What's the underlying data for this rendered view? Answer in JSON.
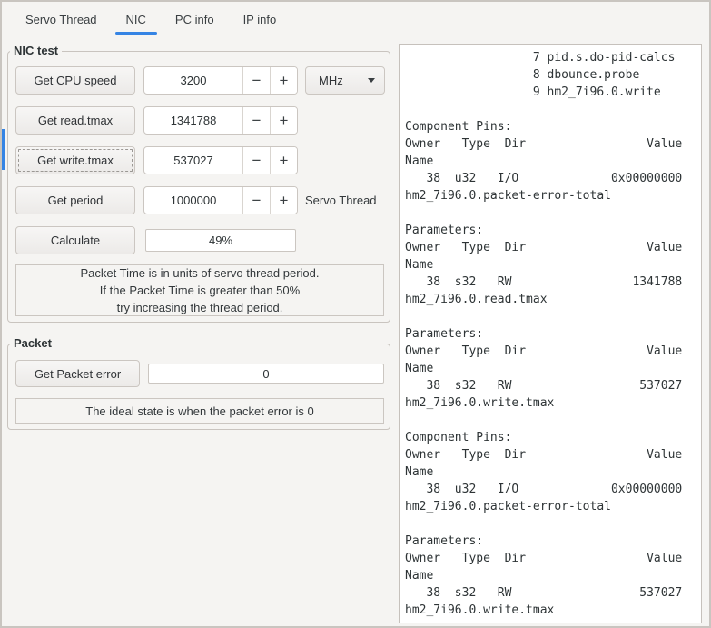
{
  "colors": {
    "accent": "#3584e4"
  },
  "tabs": {
    "servo_thread": "Servo Thread",
    "nic": "NIC",
    "pc_info": "PC info",
    "ip_info": "IP info"
  },
  "icons": {
    "minus": "−",
    "plus": "+"
  },
  "nic_test": {
    "title": "NIC test",
    "cpu_speed": {
      "button": "Get CPU speed",
      "value": "3200",
      "unit": "MHz"
    },
    "read_tmax": {
      "button": "Get read.tmax",
      "value": "1341788"
    },
    "write_tmax": {
      "button": "Get write.tmax",
      "value": "537027"
    },
    "period": {
      "button": "Get period",
      "value": "1000000",
      "label": "Servo Thread"
    },
    "calculate": {
      "button": "Calculate",
      "value": "49%"
    },
    "note": [
      "Packet Time is in units of servo thread period.",
      "If the Packet Time is greater than 50%",
      "try increasing the thread period."
    ]
  },
  "packet": {
    "title": "Packet",
    "button": "Get Packet error",
    "value": "0",
    "note": "The ideal state is when the packet error is 0"
  },
  "output": {
    "lines": [
      "                  7 pid.s.do-pid-calcs",
      "                  8 dbounce.probe",
      "                  9 hm2_7i96.0.write",
      "",
      "Component Pins:",
      "Owner   Type  Dir                 Value",
      "Name",
      "   38  u32   I/O             0x00000000",
      "hm2_7i96.0.packet-error-total",
      "",
      "Parameters:",
      "Owner   Type  Dir                 Value",
      "Name",
      "   38  s32   RW                 1341788",
      "hm2_7i96.0.read.tmax",
      "",
      "Parameters:",
      "Owner   Type  Dir                 Value",
      "Name",
      "   38  s32   RW                  537027",
      "hm2_7i96.0.write.tmax",
      "",
      "Component Pins:",
      "Owner   Type  Dir                 Value",
      "Name",
      "   38  u32   I/O             0x00000000",
      "hm2_7i96.0.packet-error-total",
      "",
      "Parameters:",
      "Owner   Type  Dir                 Value",
      "Name",
      "   38  s32   RW                  537027",
      "hm2_7i96.0.write.tmax"
    ]
  }
}
